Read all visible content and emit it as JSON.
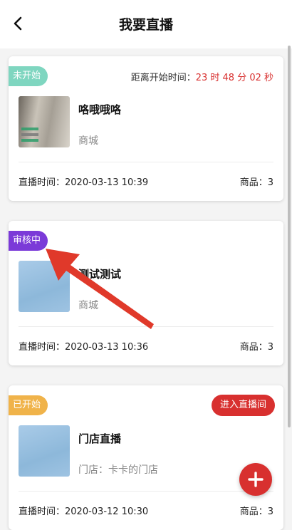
{
  "header": {
    "title": "我要直播",
    "back_icon": "chevron-left-icon"
  },
  "cards": [
    {
      "status": "未开始",
      "status_color": "#7fd6c0",
      "countdown_label": "距离开始时间：",
      "countdown_value": "23 时 48 分 02 秒",
      "name": "咯哦哦咯",
      "subtitle": "商城",
      "time_text": "直播时间：2020-03-13 10:39",
      "count_text": "商品：3"
    },
    {
      "status": "审核中",
      "status_color": "#7b3ad8",
      "name": "测试测试",
      "subtitle": "商城",
      "time_text": "直播时间：2020-03-13 10:36",
      "count_text": "商品：3"
    },
    {
      "status": "已开始",
      "status_color": "#f0b34a",
      "enter_label": "进入直播间",
      "name": "门店直播",
      "subtitle": "门店：卡卡的门店",
      "time_text": "直播时间：2020-03-12 10:30",
      "count_text": "商品：3"
    }
  ],
  "fab_icon": "plus-icon",
  "accent_color": "#d8302f"
}
